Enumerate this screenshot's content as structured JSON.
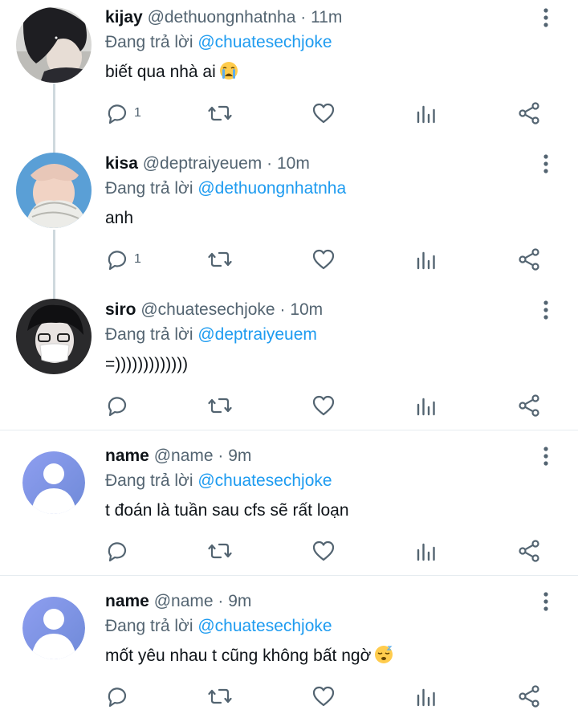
{
  "colors": {
    "link": "#1d9bf0",
    "secondary_text": "#536471",
    "primary_text": "#0f1419",
    "icon": "#536471",
    "divider": "#e6ecf0",
    "thread_line": "#cfd9de"
  },
  "tweets": [
    {
      "display_name": "kijay",
      "handle": "@dethuongnhatnha",
      "separator": "·",
      "time": "11m",
      "reply_prefix": "Đang trả lời",
      "reply_to": "@chuatesechjoke",
      "text": "biết qua nhà ai",
      "emoji": "crying-face",
      "reply_count": "1",
      "avatar": "photo-dark-hair"
    },
    {
      "display_name": "kisa",
      "handle": "@deptraiyeuem",
      "separator": "·",
      "time": "10m",
      "reply_prefix": "Đang trả lời",
      "reply_to": "@dethuongnhatnha",
      "text": "anh",
      "emoji": "",
      "reply_count": "1",
      "avatar": "photo-blue-sky"
    },
    {
      "display_name": "siro",
      "handle": "@chuatesechjoke",
      "separator": "·",
      "time": "10m",
      "reply_prefix": "Đang trả lời",
      "reply_to": "@deptraiyeuem",
      "text": "=)))))))))))))",
      "emoji": "",
      "reply_count": "",
      "avatar": "photo-mask"
    },
    {
      "display_name": "name",
      "handle": "@name",
      "separator": "·",
      "time": "9m",
      "reply_prefix": "Đang trả lời",
      "reply_to": "@chuatesechjoke",
      "text": "t đoán là tuần sau cfs sẽ rất loạn",
      "emoji": "",
      "reply_count": "",
      "avatar": "default-person"
    },
    {
      "display_name": "name",
      "handle": "@name",
      "separator": "·",
      "time": "9m",
      "reply_prefix": "Đang trả lời",
      "reply_to": "@chuatesechjoke",
      "text": "mốt yêu nhau t cũng không bất ngờ",
      "emoji": "sleepy-face",
      "reply_count": "",
      "avatar": "default-person"
    }
  ]
}
